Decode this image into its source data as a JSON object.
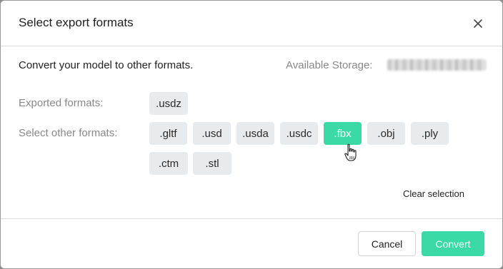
{
  "dialog": {
    "title": "Select export formats",
    "description": "Convert your model to other formats.",
    "storage_label": "Available Storage:",
    "exported_label": "Exported formats:",
    "select_label": "Select other formats:",
    "exported_formats": [
      ".usdz"
    ],
    "other_formats": [
      ".gltf",
      ".usd",
      ".usda",
      ".usdc",
      ".fbx",
      ".obj",
      ".ply",
      ".ctm",
      ".stl"
    ],
    "selected_format": ".fbx",
    "clear_label": "Clear selection",
    "cancel_label": "Cancel",
    "convert_label": "Convert",
    "accent_color": "#3ad9a5",
    "close_icon": "close-icon",
    "cursor_icon": "hand-pointer-icon"
  }
}
